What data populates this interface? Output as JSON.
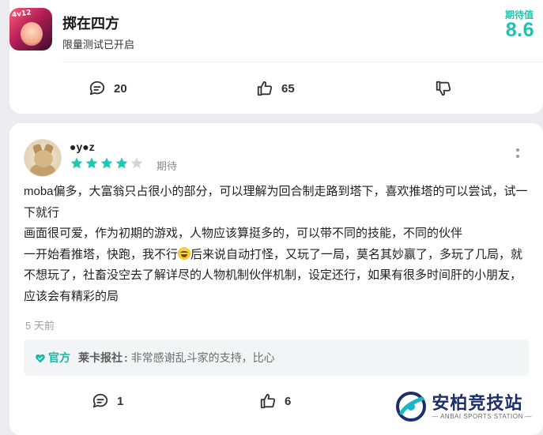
{
  "game": {
    "title": "掷在四方",
    "status": "限量测试已开启",
    "icon_tag": "4v12",
    "expectation_label": "期待值",
    "expectation_value": "8.6",
    "comments_count": "20",
    "likes_count": "65"
  },
  "review": {
    "username": "●y●z",
    "rating": 4,
    "rating_max": 5,
    "rating_label": "期待",
    "paragraphs": [
      "moba偏多，大富翁只占很小的部分，可以理解为回合制走路到塔下，喜欢推塔的可以尝试，试一下就行",
      "画面很可爱，作为初期的游戏，人物应该算挺多的，可以带不同的技能，不同的伙伴"
    ],
    "paragraph3_before_emoji": "一开始看推塔，快跑，我不行",
    "paragraph3_after_emoji": "后来说自动打怪，又玩了一局，莫名其妙赢了，多玩了几局，就不想玩了，社畜没空去了解详尽的人物机制伙伴机制，设定还行，如果有很多时间肝的小朋友，应该会有精彩的局",
    "time": "5 天前",
    "official_tag": "官方",
    "reply_author": "莱卡报社",
    "reply_colon": ":",
    "reply_text": "非常感谢乱斗家的支持，比心",
    "comments_count": "1",
    "likes_count": "6"
  },
  "watermark": {
    "title": "安柏竞技站",
    "subtitle": "— ANBAI SPORTS STATION —"
  },
  "colors": {
    "accent": "#16c6b4",
    "star_on": "#1fc7b5",
    "star_off": "#d6d6d6",
    "logo_blue": "#1b2f6b"
  }
}
